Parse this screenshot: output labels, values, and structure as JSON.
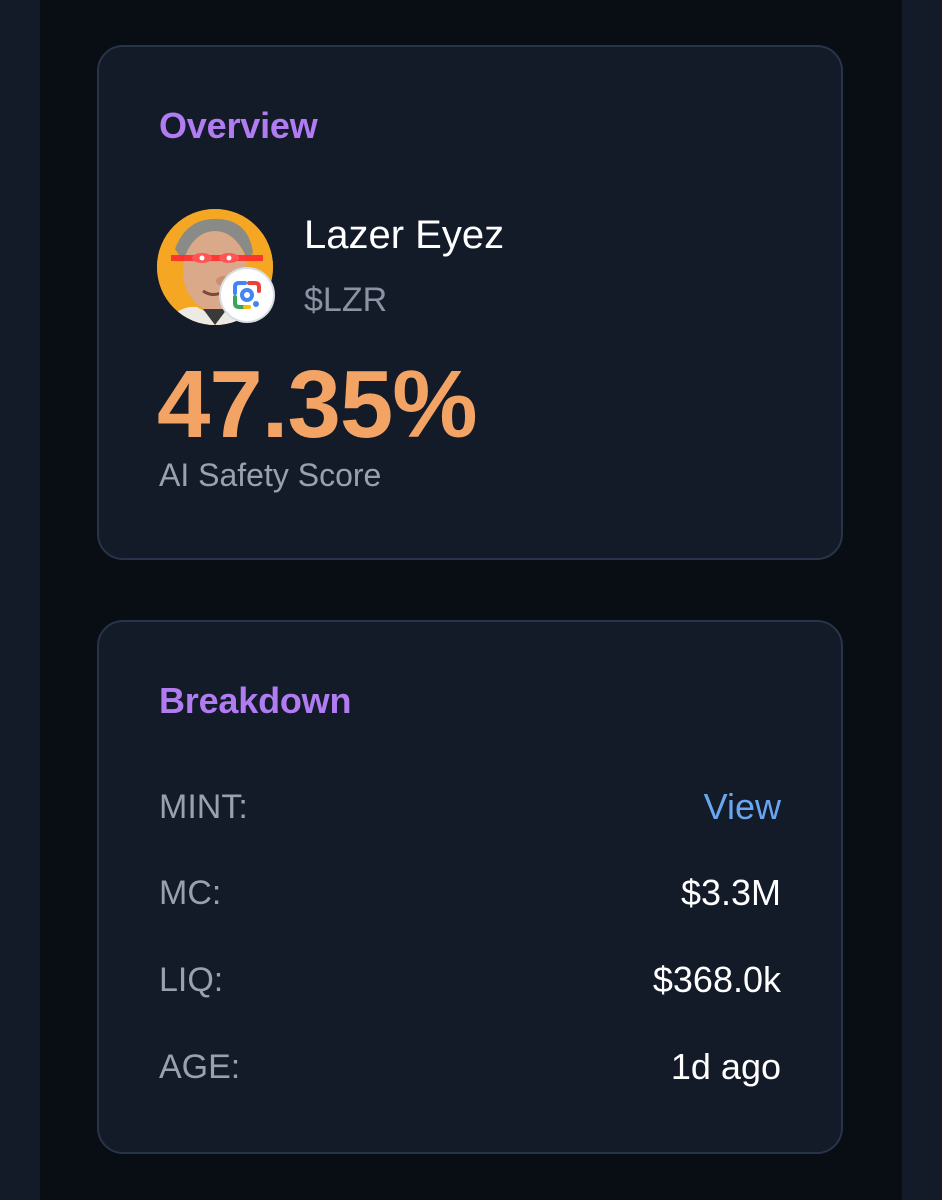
{
  "overview": {
    "title": "Overview",
    "token": {
      "name": "Lazer Eyez",
      "symbol": "$LZR",
      "avatar_bg": "#f5a623",
      "badge_icon": "google-lens-icon"
    },
    "score": {
      "value": "47.35%",
      "label": "AI Safety Score",
      "color": "#f3a465"
    }
  },
  "breakdown": {
    "title": "Breakdown",
    "rows": [
      {
        "label": "MINT:",
        "value": "View",
        "is_link": true
      },
      {
        "label": "MC:",
        "value": "$3.3M"
      },
      {
        "label": "LIQ:",
        "value": "$368.0k"
      },
      {
        "label": "AGE:",
        "value": "1d ago"
      }
    ]
  },
  "colors": {
    "accent_purple": "#b17cf2",
    "link_blue": "#69a6f2",
    "card_bg": "#131a28",
    "page_bg": "#090d14"
  }
}
